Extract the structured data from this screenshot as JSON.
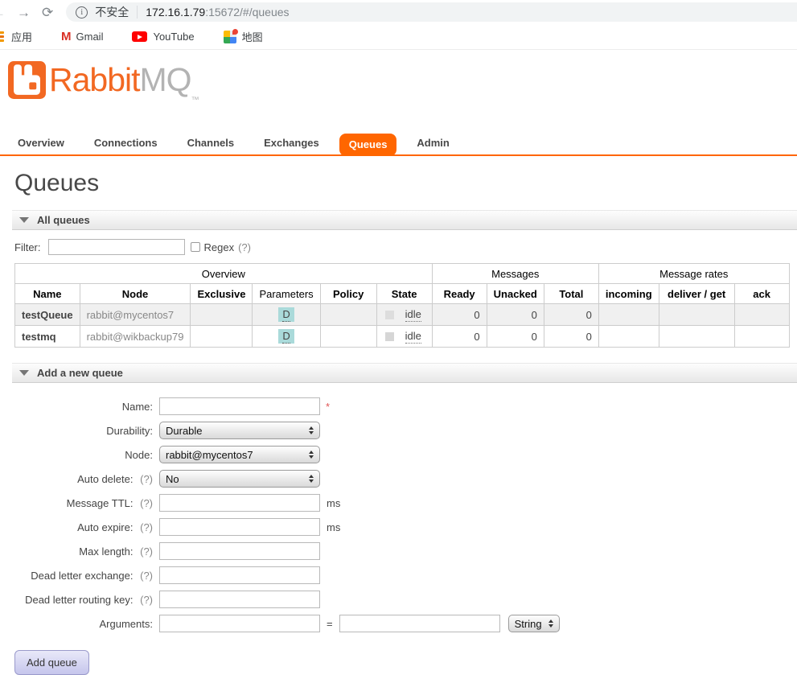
{
  "browser": {
    "back_icon": "←",
    "forward_icon": "→",
    "refresh_icon": "⟳",
    "security_label": "不安全",
    "url_host": "172.16.1.79",
    "url_path": ":15672/#/queues",
    "bookmarks": {
      "apps": "应用",
      "gmail": "Gmail",
      "youtube": "YouTube",
      "maps": "地图"
    }
  },
  "brand": {
    "word_primary": "Rabbit",
    "word_secondary": "MQ",
    "trademark": "™"
  },
  "nav": {
    "active_tab": "Queues",
    "tabs": [
      {
        "label": "Overview"
      },
      {
        "label": "Connections"
      },
      {
        "label": "Channels"
      },
      {
        "label": "Exchanges"
      },
      {
        "label": "Queues"
      },
      {
        "label": "Admin"
      }
    ]
  },
  "page_title": "Queues",
  "all_queues": {
    "title": "All queues",
    "filter": {
      "label": "Filter:",
      "value": "",
      "regex_label": "Regex",
      "help": "(?)"
    },
    "table": {
      "groups": [
        "Overview",
        "Messages",
        "Message rates"
      ],
      "columns": [
        "Name",
        "Node",
        "Exclusive",
        "Parameters",
        "Policy",
        "State",
        "Ready",
        "Unacked",
        "Total",
        "incoming",
        "deliver / get",
        "ack"
      ],
      "rows": [
        {
          "name": "testQueue",
          "node": "rabbit@mycentos7",
          "exclusive": "",
          "parameters": "D",
          "policy": "",
          "state": "idle",
          "ready": "0",
          "unacked": "0",
          "total": "0",
          "incoming": "",
          "deliver_get": "",
          "ack": ""
        },
        {
          "name": "testmq",
          "node": "rabbit@wikbackup79",
          "exclusive": "",
          "parameters": "D",
          "policy": "",
          "state": "idle",
          "ready": "0",
          "unacked": "0",
          "total": "0",
          "incoming": "",
          "deliver_get": "",
          "ack": ""
        }
      ]
    }
  },
  "add_queue": {
    "title": "Add a new queue",
    "fields": {
      "name": {
        "label": "Name:",
        "value": "",
        "required_mark": "*"
      },
      "durability": {
        "label": "Durability:",
        "value": "Durable"
      },
      "node": {
        "label": "Node:",
        "value": "rabbit@mycentos7"
      },
      "auto_delete": {
        "label": "Auto delete:",
        "help": "(?)",
        "value": "No"
      },
      "message_ttl": {
        "label": "Message TTL:",
        "help": "(?)",
        "value": "",
        "suffix": "ms"
      },
      "auto_expire": {
        "label": "Auto expire:",
        "help": "(?)",
        "value": "",
        "suffix": "ms"
      },
      "max_length": {
        "label": "Max length:",
        "help": "(?)",
        "value": ""
      },
      "dead_letter_exchange": {
        "label": "Dead letter exchange:",
        "help": "(?)",
        "value": ""
      },
      "dead_letter_routing_key": {
        "label": "Dead letter routing key:",
        "help": "(?)",
        "value": ""
      },
      "arguments": {
        "label": "Arguments:",
        "key_value": "",
        "equals": "=",
        "value": "",
        "type_value": "String"
      }
    },
    "submit_label": "Add queue"
  },
  "colors": {
    "accent_orange": "#ff6600",
    "logo_orange": "#f26822",
    "badge_teal": "#aadada",
    "button_purple": "#c5c5ec",
    "row_alt_gray": "#f0f0f0"
  }
}
